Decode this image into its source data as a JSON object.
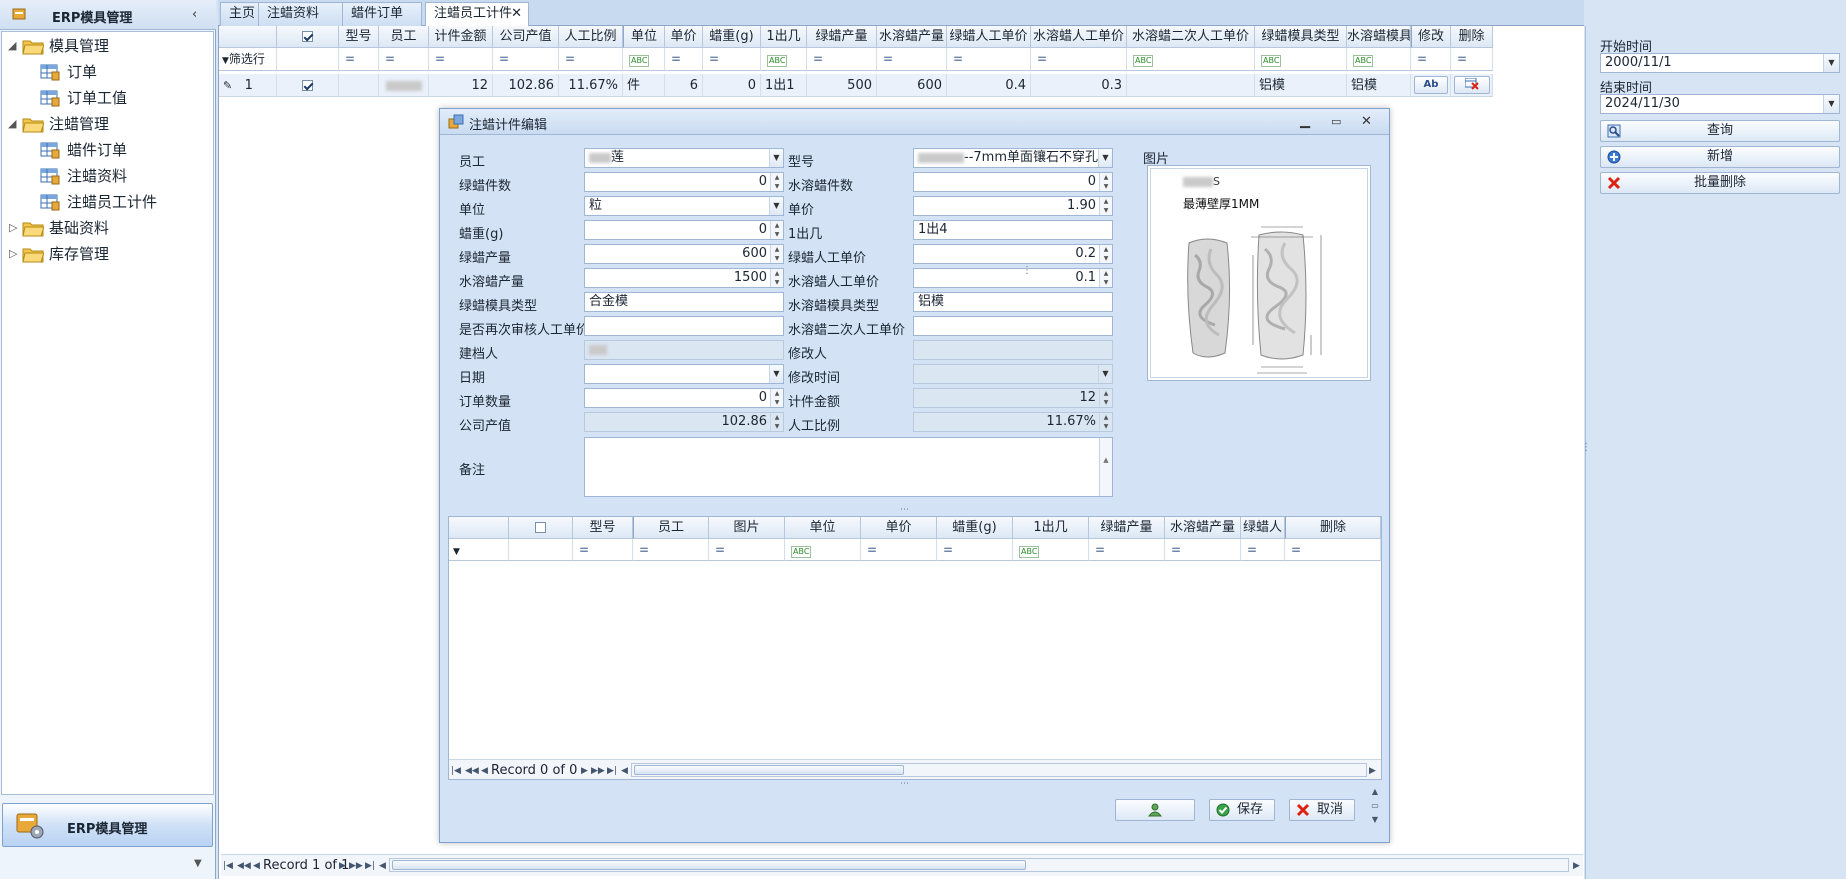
{
  "sidebar": {
    "title": "ERP模具管理",
    "footer_label": "ERP模具管理",
    "tree": [
      {
        "label": "模具管理",
        "level": 0,
        "expanded": true,
        "icon": "folder-icon"
      },
      {
        "label": "订单",
        "level": 1,
        "icon": "table-icon"
      },
      {
        "label": "订单工值",
        "level": 1,
        "icon": "table-icon"
      },
      {
        "label": "注蜡管理",
        "level": 0,
        "expanded": true,
        "icon": "folder-icon"
      },
      {
        "label": "蜡件订单",
        "level": 1,
        "icon": "table-icon"
      },
      {
        "label": "注蜡资料",
        "level": 1,
        "icon": "table-icon"
      },
      {
        "label": "注蜡员工计件",
        "level": 1,
        "icon": "table-icon"
      },
      {
        "label": "基础资料",
        "level": 0,
        "expanded": false,
        "icon": "folder-icon"
      },
      {
        "label": "库存管理",
        "level": 0,
        "expanded": false,
        "icon": "folder-icon"
      }
    ]
  },
  "tabs": [
    {
      "label": "主页"
    },
    {
      "label": "注蜡资料"
    },
    {
      "label": "蜡件订单"
    },
    {
      "label": "注蜡员工计件",
      "active": true
    }
  ],
  "grid": {
    "filter_label": "筛选行",
    "columns": [
      "",
      "",
      "型号",
      "员工",
      "计件金额",
      "公司产值",
      "人工比例",
      "单位",
      "单价",
      "蜡重(g)",
      "1出几",
      "绿蜡产量",
      "水溶蜡产量",
      "绿蜡人工单价",
      "水溶蜡人工单价",
      "水溶蜡二次人工单价",
      "绿蜡模具类型",
      "水溶蜡模具",
      "修改",
      "删除"
    ],
    "row": {
      "index": "1",
      "amount": "12",
      "output": "102.86",
      "ratio": "11.67%",
      "unit": "件",
      "price": "6",
      "weight": "0",
      "out_count": "1出1",
      "green_qty": "500",
      "water_qty": "600",
      "green_price": "0.4",
      "water_price": "0.3",
      "water_price2": "",
      "green_mold": "铝模",
      "water_mold": "铝模"
    },
    "record_text": "Record 1 of 1"
  },
  "right_panel": {
    "start_label": "开始时间",
    "start_value": "2000/11/1",
    "end_label": "结束时间",
    "end_value": "2024/11/30",
    "query_label": "查询",
    "add_label": "新增",
    "batch_delete_label": "批量删除"
  },
  "dialog": {
    "title": "注蜡计件编辑",
    "fields": {
      "employee_label": "员工",
      "employee_value": "莲",
      "model_label": "型号",
      "model_value": "--7mm单面镶石不穿孔",
      "green_count_label": "绿蜡件数",
      "green_count_value": "0",
      "water_count_label": "水溶蜡件数",
      "water_count_value": "0",
      "unit_label": "单位",
      "unit_value": "粒",
      "price_label": "单价",
      "price_value": "1.90",
      "weight_label": "蜡重(g)",
      "weight_value": "0",
      "out_label": "1出几",
      "out_value": "1出4",
      "green_qty_label": "绿蜡产量",
      "green_qty_value": "600",
      "green_price_label": "绿蜡人工单价",
      "green_price_value": "0.2",
      "water_qty_label": "水溶蜡产量",
      "water_qty_value": "1500",
      "water_price_label": "水溶蜡人工单价",
      "water_price_value": "0.1",
      "green_mold_label": "绿蜡模具类型",
      "green_mold_value": "合金模",
      "water_mold_label": "水溶蜡模具类型",
      "water_mold_value": "铝模",
      "recheck_label": "是否再次审核人工单价",
      "recheck_value": "",
      "water_price2_label": "水溶蜡二次人工单价",
      "water_price2_value": "",
      "creator_label": "建档人",
      "modifier_label": "修改人",
      "date_label": "日期",
      "modtime_label": "修改时间",
      "order_qty_label": "订单数量",
      "order_qty_value": "0",
      "amount_label": "计件金额",
      "amount_value": "12",
      "company_output_label": "公司产值",
      "company_output_value": "102.86",
      "ratio_label": "人工比例",
      "ratio_value": "11.67%",
      "remark_label": "备注",
      "picture_label": "图片",
      "picture_caption1": "S",
      "picture_caption2": "最薄壁厚1MM"
    },
    "subgrid": {
      "columns": [
        "",
        "型号",
        "员工",
        "图片",
        "单位",
        "单价",
        "蜡重(g)",
        "1出几",
        "绿蜡产量",
        "水溶蜡产量",
        "绿蜡人",
        "删除"
      ],
      "record_text": "Record 0 of 0"
    },
    "save_label": "保存",
    "cancel_label": "取消"
  },
  "colors": {
    "accent": "#c9dbf1",
    "window_bg": "#d6e4f4",
    "row_select": "#eaf1fb"
  }
}
